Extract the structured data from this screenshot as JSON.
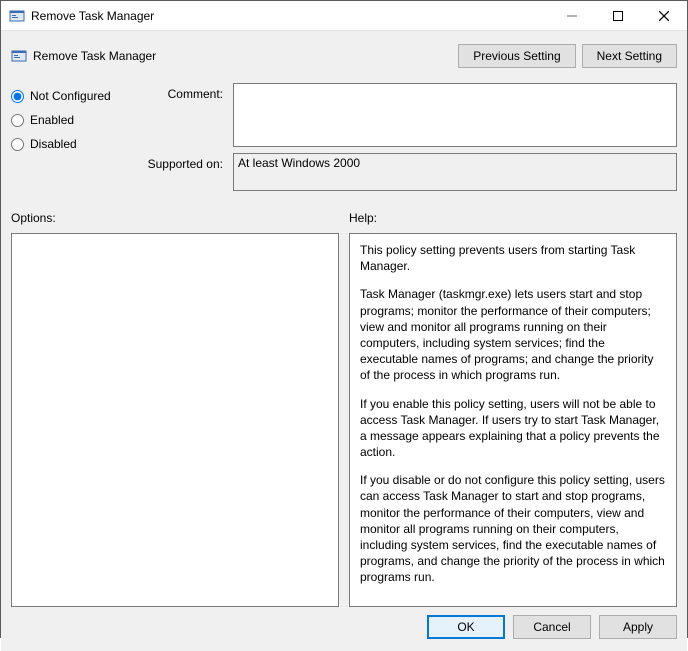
{
  "window": {
    "title": "Remove Task Manager"
  },
  "header": {
    "policy_title": "Remove Task Manager",
    "prev_label": "Previous Setting",
    "next_label": "Next Setting"
  },
  "state": {
    "not_configured": "Not Configured",
    "enabled": "Enabled",
    "disabled": "Disabled",
    "selected": "not_configured"
  },
  "fields": {
    "comment_label": "Comment:",
    "comment_value": "",
    "supported_label": "Supported on:",
    "supported_value": "At least Windows 2000"
  },
  "panes": {
    "options_label": "Options:",
    "help_label": "Help:",
    "options_text": "",
    "help_p1": "This policy setting prevents users from starting Task Manager.",
    "help_p2": "Task Manager (taskmgr.exe) lets users start and stop programs; monitor the performance of their computers; view and monitor all programs running on their computers, including system services; find the executable names of programs; and change the priority of the process in which programs run.",
    "help_p3": "If you enable this policy setting, users will not be able to access Task Manager. If users try to start Task Manager, a message appears explaining that a policy prevents the action.",
    "help_p4": "If you disable or do not configure this policy setting, users can access Task Manager to  start and stop programs, monitor the performance of their computers, view and monitor all programs running on their computers, including system services, find the executable names of programs, and change the priority of the process in which programs run."
  },
  "footer": {
    "ok": "OK",
    "cancel": "Cancel",
    "apply": "Apply"
  }
}
